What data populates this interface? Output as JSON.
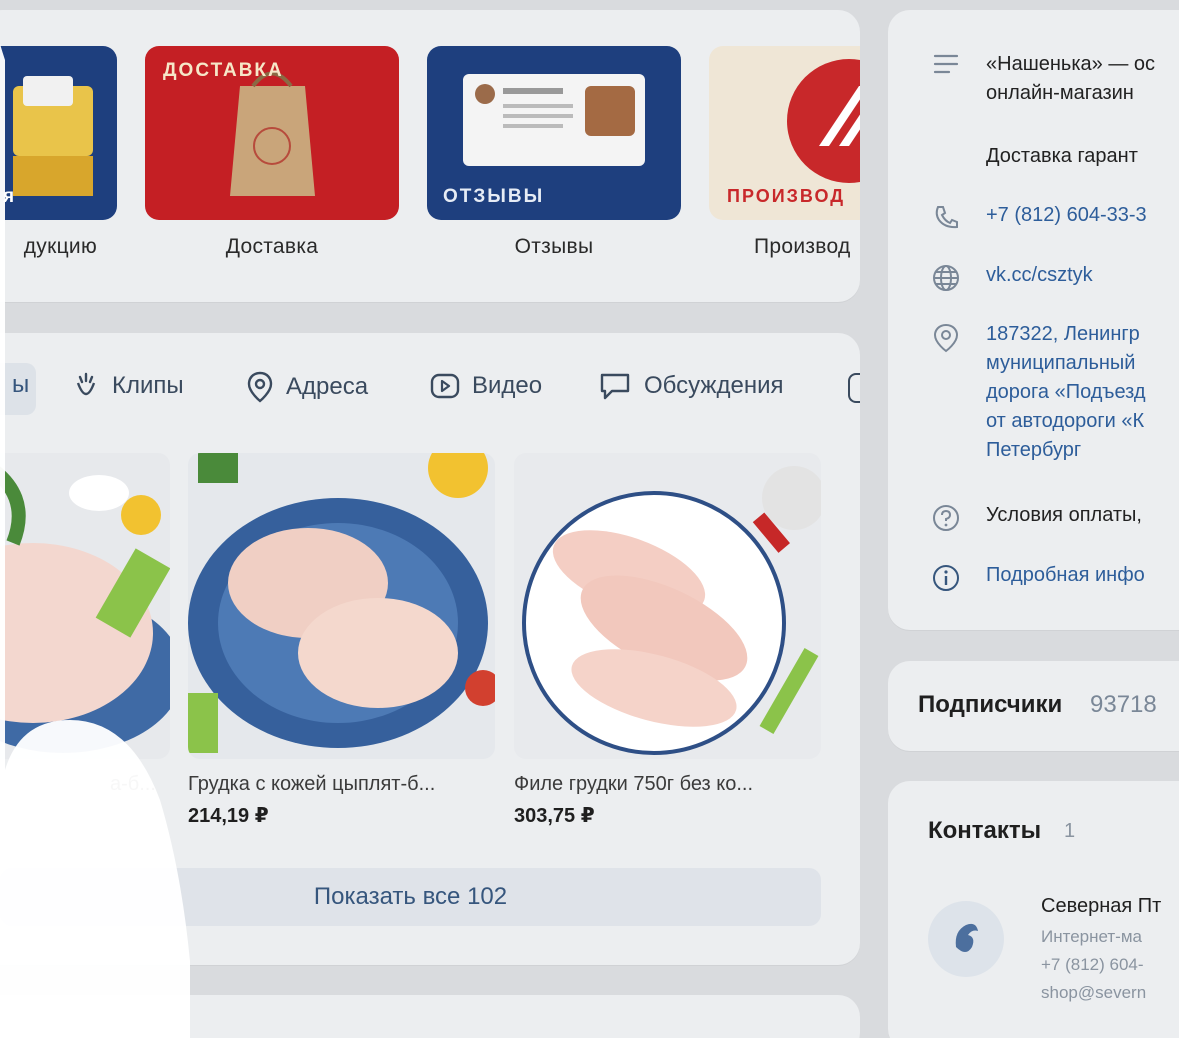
{
  "cover": {
    "tiles": [
      {
        "label": "дукцию",
        "word": "я"
      },
      {
        "label": "Доставка",
        "word": "ДОСТАВКА"
      },
      {
        "label": "Отзывы",
        "word": "ОТЗЫВЫ"
      },
      {
        "label": "Производ",
        "word": "ПРОИЗВОД"
      }
    ]
  },
  "tabs": [
    {
      "label": "ы",
      "icon": "products-icon"
    },
    {
      "label": "Клипы",
      "icon": "clips-icon"
    },
    {
      "label": "Адреса",
      "icon": "location-icon"
    },
    {
      "label": "Видео",
      "icon": "video-icon"
    },
    {
      "label": "Обсуждения",
      "icon": "discussion-icon"
    }
  ],
  "products": [
    {
      "name": "а-б...",
      "price": ""
    },
    {
      "name": "Грудка с кожей цыплят-б...",
      "price": "214,19 ₽"
    },
    {
      "name": "Филе грудки 750г без ко...",
      "price": "303,75 ₽"
    }
  ],
  "show_all": "Показать все 102",
  "info": {
    "description": "«Нашенька» — ос\nонлайн-магазин",
    "delivery": "Доставка гарант",
    "phone": "+7 (812) 604-33-3",
    "site": "vk.cc/csztyk",
    "address": "187322, Ленингр\nмуниципальный\nдорога «Подъезд\nот автодороги «К\nПетербург",
    "payment": "Условия оплаты,",
    "details": "Подробная инфо"
  },
  "subscribers": {
    "label": "Подписчики",
    "count": "93718"
  },
  "contacts": {
    "label": "Контакты",
    "count": "1",
    "name": "Северная Пт",
    "role": "Интернет-ма",
    "phone": "+7 (812) 604-",
    "email": "shop@severn"
  },
  "colors": {
    "accent": "#2d5d9a",
    "tab_text": "#3a4a5e",
    "card_bg": "#eceef0"
  }
}
